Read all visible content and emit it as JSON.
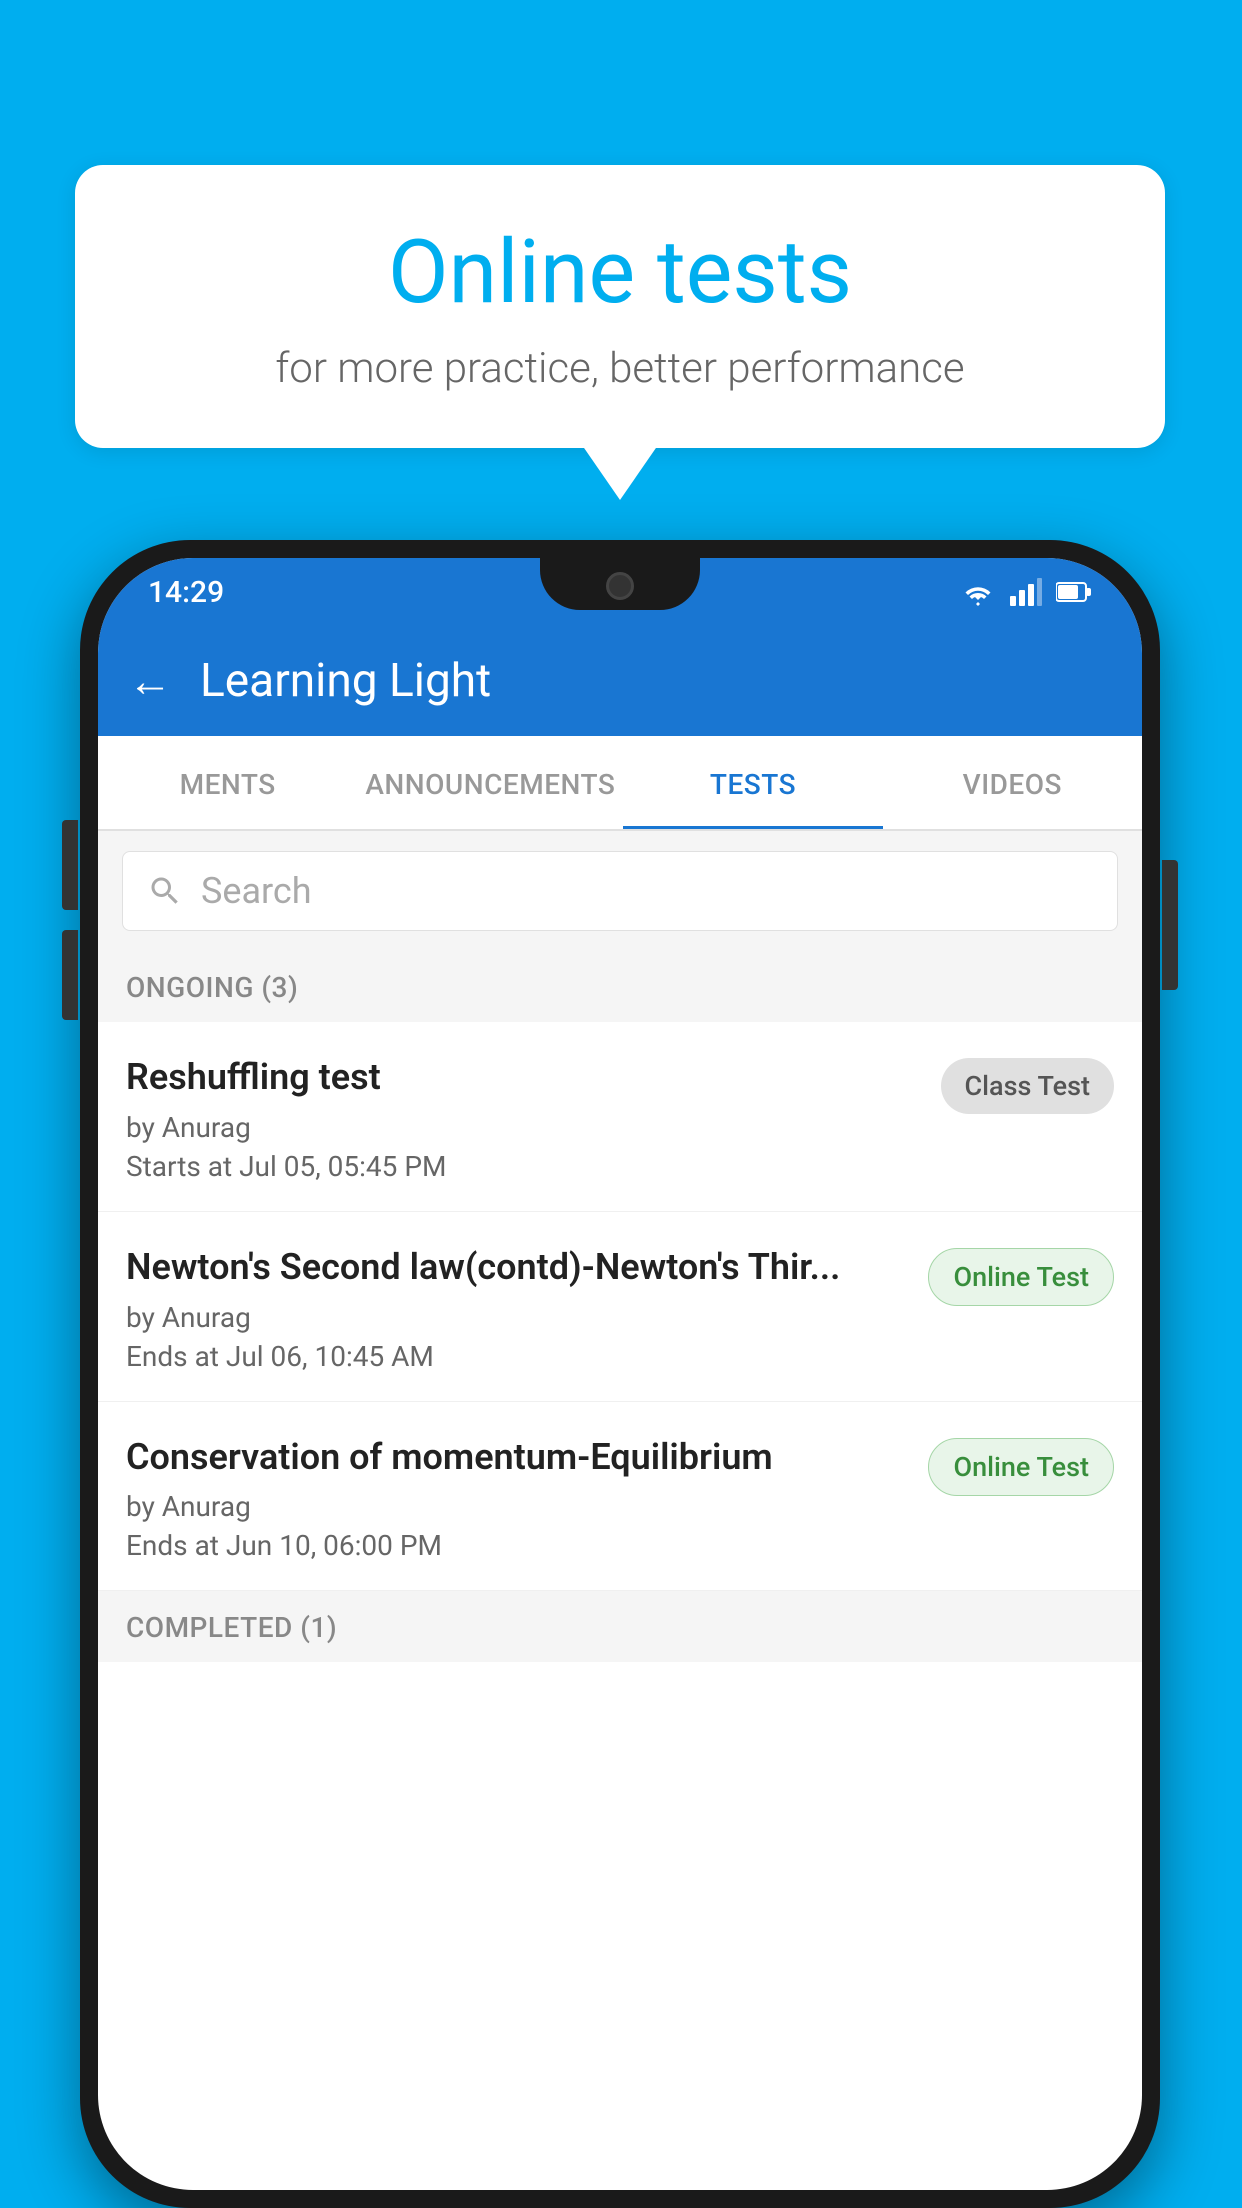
{
  "background": {
    "color": "#00AEEF"
  },
  "speech_bubble": {
    "title": "Online tests",
    "subtitle": "for more practice, better performance"
  },
  "phone": {
    "status_bar": {
      "time": "14:29",
      "icons": [
        "wifi",
        "signal",
        "battery"
      ]
    },
    "app_bar": {
      "back_label": "←",
      "title": "Learning Light"
    },
    "tabs": [
      {
        "label": "MENTS",
        "active": false
      },
      {
        "label": "ANNOUNCEMENTS",
        "active": false
      },
      {
        "label": "TESTS",
        "active": true
      },
      {
        "label": "VIDEOS",
        "active": false
      }
    ],
    "search": {
      "placeholder": "Search"
    },
    "sections": [
      {
        "header": "ONGOING (3)",
        "items": [
          {
            "name": "Reshuffling test",
            "by": "by Anurag",
            "time_label": "Starts at",
            "time": "Jul 05, 05:45 PM",
            "badge": "Class Test",
            "badge_type": "class"
          },
          {
            "name": "Newton's Second law(contd)-Newton's Thir...",
            "by": "by Anurag",
            "time_label": "Ends at",
            "time": "Jul 06, 10:45 AM",
            "badge": "Online Test",
            "badge_type": "online"
          },
          {
            "name": "Conservation of momentum-Equilibrium",
            "by": "by Anurag",
            "time_label": "Ends at",
            "time": "Jun 10, 06:00 PM",
            "badge": "Online Test",
            "badge_type": "online"
          }
        ]
      }
    ],
    "completed_header": "COMPLETED (1)"
  }
}
